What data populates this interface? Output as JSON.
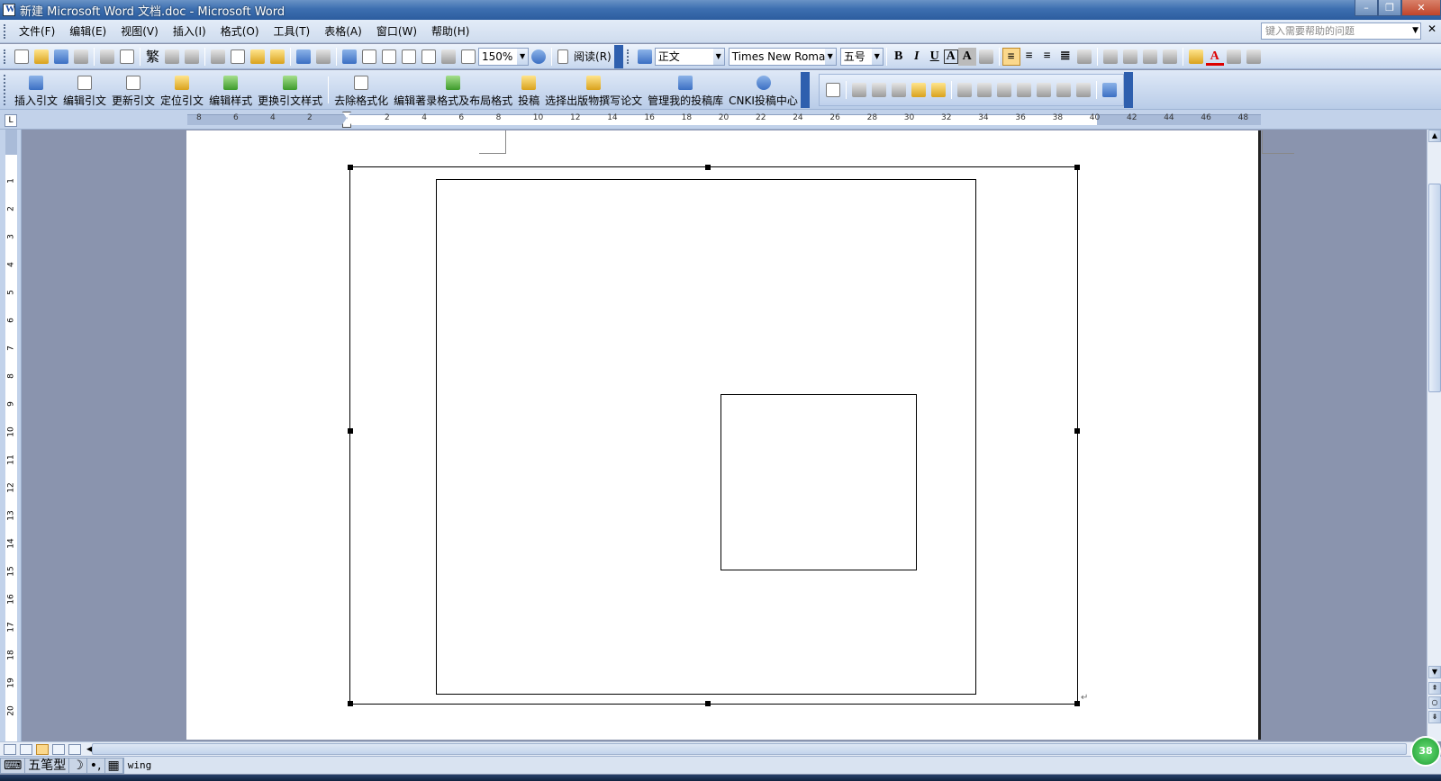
{
  "window": {
    "title": "新建 Microsoft Word 文档.doc - Microsoft Word",
    "controls": [
      "–",
      "❐",
      "✕"
    ]
  },
  "menubar": {
    "items": [
      "文件(F)",
      "编辑(E)",
      "视图(V)",
      "插入(I)",
      "格式(O)",
      "工具(T)",
      "表格(A)",
      "窗口(W)",
      "帮助(H)"
    ],
    "help_placeholder": "键入需要帮助的问题",
    "close_label": "✕"
  },
  "toolbar_standard": {
    "trad_label": "繁",
    "zoom": "150%",
    "read_label": "阅读(R)"
  },
  "toolbar_formatting": {
    "style": "正文",
    "font": "Times New Roman",
    "size": "五号",
    "bold": "B",
    "italic": "I",
    "underline": "U",
    "char_border": "A",
    "char_shading": "A"
  },
  "toolbar_cnki": {
    "items": [
      "插入引文",
      "编辑引文",
      "更新引文",
      "定位引文",
      "编辑样式",
      "更换引文样式",
      "去除格式化",
      "编辑著录格式及布局格式",
      "投稿",
      "选择出版物撰写论文",
      "管理我的投稿库",
      "CNKI投稿中心"
    ]
  },
  "ruler": {
    "corner": "L",
    "left_numbers": [
      "8",
      "6",
      "4",
      "2"
    ],
    "right_numbers": [
      "2",
      "4",
      "6",
      "8",
      "10",
      "12",
      "14",
      "16",
      "18",
      "20",
      "22",
      "24",
      "26",
      "28",
      "30",
      "32",
      "34",
      "36",
      "38",
      "40",
      "42",
      "44",
      "46",
      "48"
    ],
    "vertical_numbers": [
      "1",
      "2",
      "3",
      "4",
      "5",
      "6",
      "7",
      "8",
      "9",
      "10",
      "11",
      "12",
      "13",
      "14",
      "15",
      "16",
      "17",
      "18",
      "19",
      "20"
    ]
  },
  "statusbar": {
    "ime_icon": "⌨",
    "ime_mode": "五笔型",
    "ime_moon": "☽",
    "ime_punct": "•,",
    "ime_keyboard": "▦",
    "text": "wing"
  },
  "badge": {
    "value": "38"
  },
  "colors": {
    "titlebar": "#3d6fb0",
    "toolbar": "#c7d7ee",
    "workspace": "#8a94ae",
    "page": "#ffffff"
  }
}
